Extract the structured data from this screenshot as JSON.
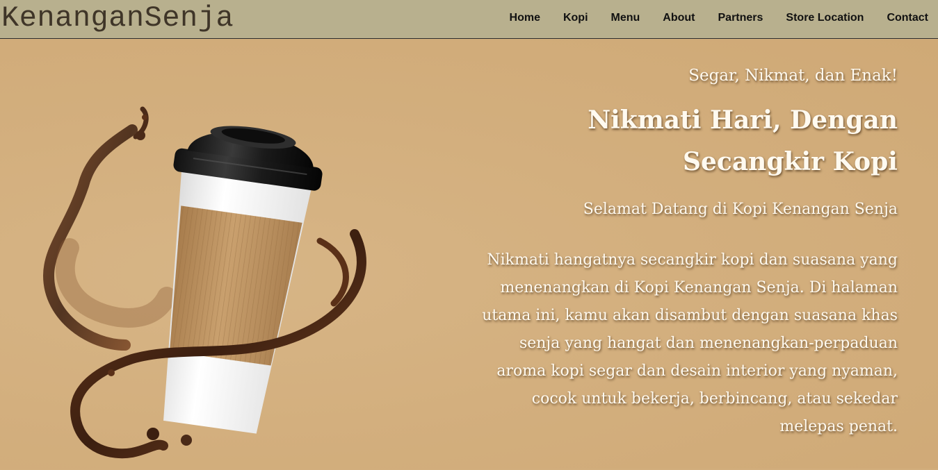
{
  "navbar": {
    "brand": "KenanganSenja",
    "links": [
      "Home",
      "Kopi",
      "Menu",
      "About",
      "Partners",
      "Store Location",
      "Contact"
    ]
  },
  "hero": {
    "tagline": "Segar, Nikmat, dan Enak!",
    "headline_line1": "Nikmati Hari, Dengan",
    "headline_line2": "Secangkir Kopi",
    "welcome": "Selamat Datang di Kopi Kenangan Senja",
    "description": "Nikmati hangatnya secangkir kopi dan suasana yang menenangkan di Kopi Kenangan Senja. Di halaman utama ini, kamu akan disambut dengan suasana khas senja yang hangat dan menenangkan-perpaduan aroma kopi segar dan desain interior yang nyaman, cocok untuk bekerja, berbincang, atau sekedar melepas penat."
  },
  "colors": {
    "navbar_bg": "#b8b08e",
    "hero_bg": "#d2ae7d",
    "brand_text": "#3f3528",
    "hero_text": "#fffaf0",
    "coffee": "#4a2a18"
  },
  "icons": {
    "hero_image": "coffee-cup-with-splash-illustration"
  }
}
